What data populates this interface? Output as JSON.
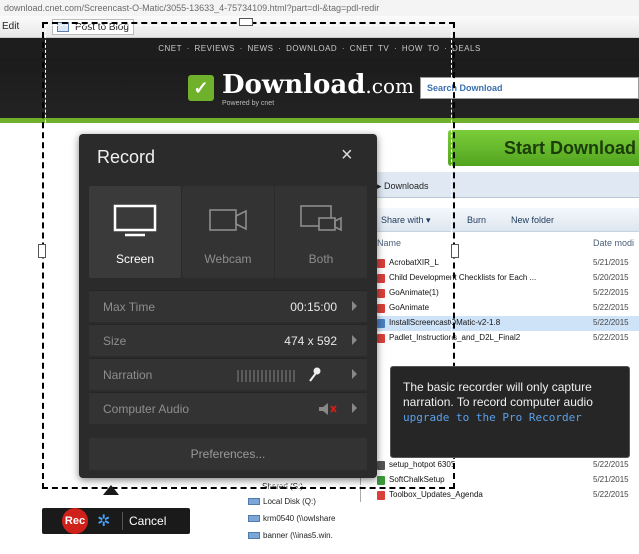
{
  "browser": {
    "url": "download.cnet.com/Screencast-O-Matic/3055-13633_4-75734109.html?part=dl-&tag=pdl-redir",
    "url_host": "download.cnet.com",
    "toolbar": {
      "edit_label": "Edit",
      "post_to_blog_label": "Post to Blog"
    }
  },
  "site": {
    "nav": "CNET  ·  REVIEWS  ·  NEWS  ·  DOWNLOAD  ·  CNET TV  ·  HOW TO  ·  DEALS",
    "logo_mark": "✓",
    "logo_text": "Download",
    "logo_suffix": ".com",
    "powered_by": "Powered by cnet",
    "search_placeholder": "Search Download",
    "start_download": "Start Download"
  },
  "explorer": {
    "breadcrumb": "▸ Downloads",
    "share_with": "Share with ▾",
    "burn": "Burn",
    "new_folder": "New folder",
    "col_name": "Name",
    "col_date": "Date modi",
    "files": [
      {
        "name": "AcrobatXIR_L",
        "date": "5/21/2015"
      },
      {
        "name": "Child Development Checklists for Each ...",
        "date": "5/20/2015"
      },
      {
        "name": "GoAnimate(1)",
        "date": "5/22/2015"
      },
      {
        "name": "GoAnimate",
        "date": "5/22/2015"
      },
      {
        "name": "InstallScreencastOMatic-v2-1.8",
        "date": "5/22/2015"
      },
      {
        "name": "Padlet_Instructions_and_D2L_Final2",
        "date": "5/22/2015"
      }
    ],
    "files_bottom": [
      {
        "name": "setup_hotpot 6305",
        "date": "5/22/2015"
      },
      {
        "name": "SoftChalkSetup",
        "date": "5/21/2015"
      },
      {
        "name": "Toolbox_Updates_Agenda",
        "date": "5/22/2015"
      }
    ],
    "nav_items": [
      "Local Disk (Q:)",
      "krm0540 (\\\\owlshare",
      "banner (\\\\inas5.win."
    ],
    "shared_label": "Shared (S:)"
  },
  "recorder": {
    "title": "Record",
    "modes": [
      {
        "label": "Screen",
        "icon": "monitor-icon",
        "active": true
      },
      {
        "label": "Webcam",
        "icon": "webcam-icon",
        "active": false
      },
      {
        "label": "Both",
        "icon": "screen-and-webcam-icon",
        "active": false
      }
    ],
    "settings": {
      "max_time_label": "Max Time",
      "max_time_value": "00:15:00",
      "size_label": "Size",
      "size_value": "474 x 592",
      "narration_label": "Narration",
      "computer_audio_label": "Computer Audio"
    },
    "preferences": "Preferences...",
    "tooltip": {
      "text": "The basic recorder will only capture narration. To record computer audio",
      "link": "upgrade to the Pro Recorder"
    },
    "bar": {
      "rec": "Rec",
      "cancel": "Cancel"
    }
  },
  "colors": {
    "accent_green": "#6fb12a",
    "rec_red": "#d0201a",
    "link_blue": "#5aa0e8"
  }
}
